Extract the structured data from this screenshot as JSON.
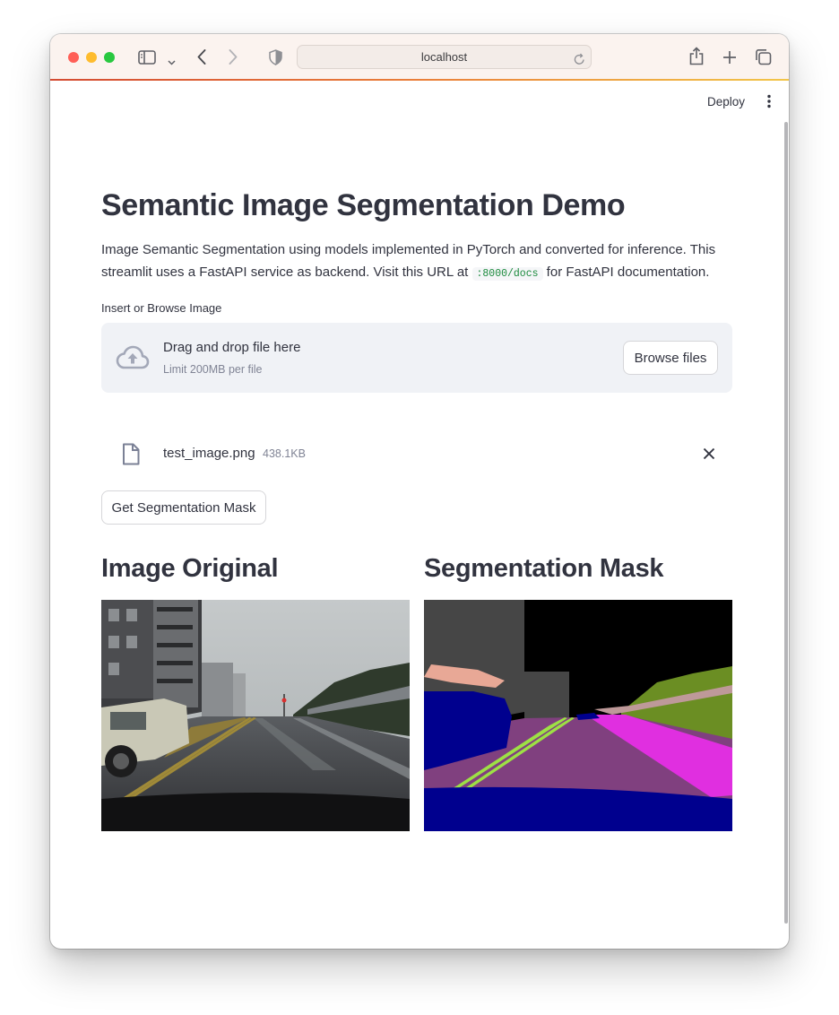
{
  "browser": {
    "url": "localhost",
    "traffic_lights": {
      "close": "#ff5f57",
      "minimize": "#febc2e",
      "zoom": "#28c840"
    }
  },
  "toolbar": {
    "deploy_label": "Deploy"
  },
  "page": {
    "title": "Semantic Image Segmentation Demo",
    "description_part1": "Image Semantic Segmentation using models implemented in PyTorch and converted for inference. This streamlit uses a FastAPI service as backend. Visit this URL at ",
    "description_code": ":8000/docs",
    "description_part2": " for FastAPI documentation."
  },
  "uploader": {
    "label": "Insert or Browse Image",
    "drop_text": "Drag and drop file here",
    "limit_text": "Limit 200MB per file",
    "browse_label": "Browse files",
    "file": {
      "name": "test_image.png",
      "size": "438.1KB"
    }
  },
  "actions": {
    "get_mask_label": "Get Segmentation Mask"
  },
  "results": {
    "original_heading": "Image Original",
    "mask_heading": "Segmentation Mask"
  },
  "colors": {
    "text": "#31333f",
    "muted": "#808495",
    "dropzone_bg": "#f0f2f6",
    "code_green": "#1a8a3c",
    "mask_road": "#80407f",
    "mask_sidewalk": "#e02fe0",
    "mask_vehicle": "#00008e",
    "mask_vegetation": "#6b8e23",
    "mask_building": "#464646",
    "mask_lane": "#9de045",
    "mask_sky": "#000000"
  }
}
